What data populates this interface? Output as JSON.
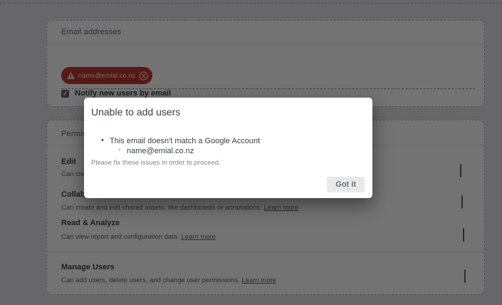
{
  "theme": {
    "error_chip_color": "#c0392f",
    "checked_checkbox_color": "#5f6368",
    "dialog_button_bg": "#e9e9e9",
    "card_bg": "#ffffff"
  },
  "email_section": {
    "title": "Email addresses",
    "chip": {
      "email": "name@emial.co.nz"
    },
    "notify": {
      "label": "Notify new users by email",
      "checked": true
    }
  },
  "permissions_section": {
    "title": "Permissions",
    "rows": [
      {
        "name": "Edit",
        "description": "Can cre",
        "link": "",
        "checked": false
      },
      {
        "name": "Collaborate",
        "description": "Can create and edit shared assets, like dashboards or annotations.",
        "link": "Learn more",
        "checked": false
      },
      {
        "name": "Read & Analyze",
        "description": "Can view report and configuration data.",
        "link": "Learn more",
        "checked": true
      },
      {
        "name": "Manage Users",
        "description": "Can add users, delete users, and change user permissions.",
        "link": "Learn more",
        "checked": false
      }
    ]
  },
  "dialog": {
    "title": "Unable to add users",
    "issues": [
      {
        "text": "This email doesn't match a Google Account",
        "details": [
          "name@emial.co.nz"
        ]
      }
    ],
    "note": "Please fix these issues in order to proceed.",
    "confirm_label": "Got it"
  }
}
